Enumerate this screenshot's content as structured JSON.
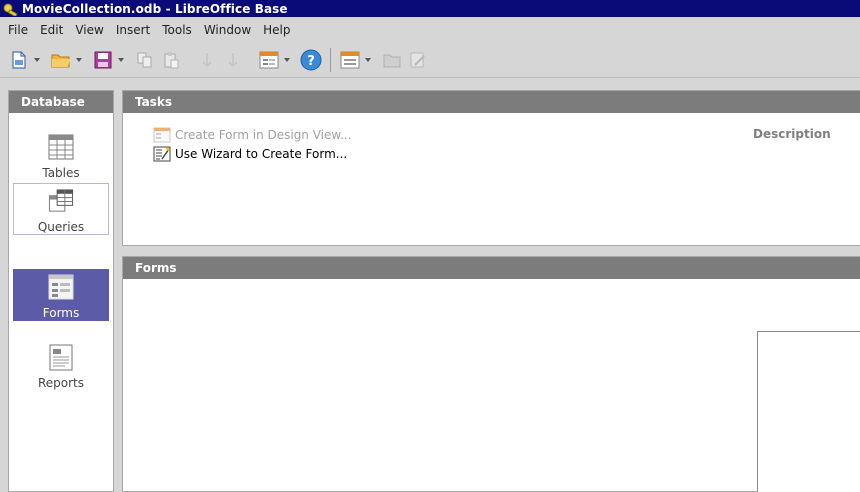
{
  "window": {
    "title": "MovieCollection.odb - LibreOffice Base"
  },
  "menubar": {
    "items": [
      "File",
      "Edit",
      "View",
      "Insert",
      "Tools",
      "Window",
      "Help"
    ]
  },
  "database_panel": {
    "header": "Database",
    "items": [
      {
        "label": "Tables",
        "icon": "table-icon"
      },
      {
        "label": "Queries",
        "icon": "query-icon"
      },
      {
        "label": "Forms",
        "icon": "form-icon",
        "selected": true
      },
      {
        "label": "Reports",
        "icon": "report-icon"
      }
    ]
  },
  "tasks_panel": {
    "header": "Tasks",
    "items": [
      {
        "label": "Create Form in Design View...",
        "enabled": false
      },
      {
        "label": "Use Wizard to Create Form...",
        "enabled": true
      }
    ],
    "description_label": "Description"
  },
  "forms_panel": {
    "header": "Forms"
  },
  "colors": {
    "titlebar": "#0a0a78",
    "selection": "#5b5ba8",
    "panel_header": "#7c7c7c"
  }
}
